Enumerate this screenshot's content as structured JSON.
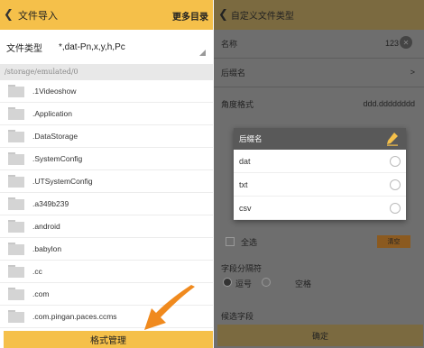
{
  "left": {
    "title": "文件导入",
    "more": "更多目录",
    "file_type_label": "文件类型",
    "file_type_value": "*,dat-Pn,x,y,h,Pc",
    "path": "/storage/emulated/0",
    "folders": [
      ".1Videoshow",
      ".Application",
      ".DataStorage",
      ".SystemConfig",
      ".UTSystemConfig",
      ".a349b239",
      ".android",
      ".babylon",
      ".cc",
      ".com",
      ".com.pingan.paces.ccms"
    ],
    "manage_button": "格式管理"
  },
  "right": {
    "title": "自定义文件类型",
    "name_label": "名称",
    "name_value": "123",
    "suffix_label": "后缀名",
    "angle_label": "角度格式",
    "angle_value": "ddd.dddddddd",
    "select_all": "全选",
    "clear": "清空",
    "sep_label": "字段分隔符",
    "comma": "逗号",
    "space": "空格",
    "choose_field": "候选字段",
    "ok": "确定",
    "dialog": {
      "title": "后缀名",
      "options": [
        "dat",
        "txt",
        "csv"
      ]
    }
  },
  "colors": {
    "accent": "#f5c04a",
    "arrow": "#f08a1e"
  },
  "icons": {
    "back": "back-chevron-icon",
    "folder": "folder-icon",
    "edit": "pencil-icon"
  }
}
